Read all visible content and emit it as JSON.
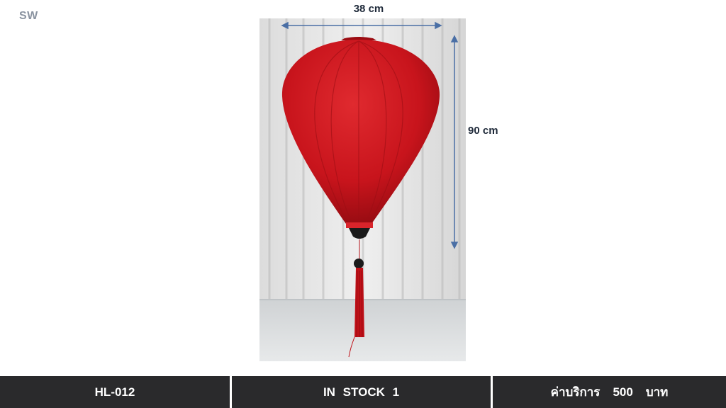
{
  "watermark": "SW",
  "dimensions": {
    "width_label": "38 cm",
    "height_label": "90 cm"
  },
  "product": {
    "image_icon": "red-hanging-lantern",
    "lantern_color": "#c8141c",
    "tassel_color": "#c01018"
  },
  "footer": {
    "code": "HL-012",
    "stock": "IN  STOCK  1",
    "price_prefix": "ค่าบริการ",
    "price_value": "500",
    "price_unit": "บาท"
  },
  "colors": {
    "footer_bg": "#2a2a2c",
    "dimension_arrow": "#4a6fa5"
  }
}
